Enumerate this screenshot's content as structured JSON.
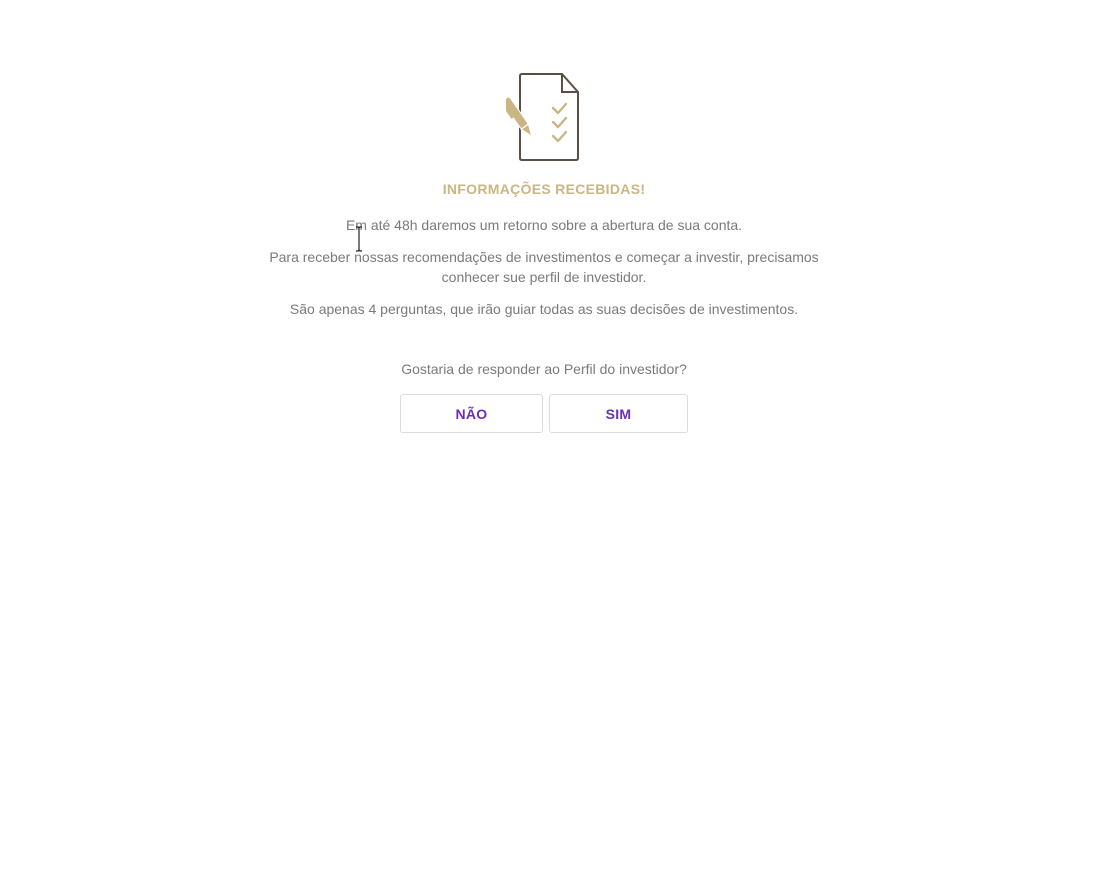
{
  "confirmation": {
    "icon": "document-checklist-pen-icon",
    "title": "INFORMAÇÕES RECEBIDAS!",
    "line1": "Em até 48h daremos um retorno sobre a abertura de sua conta.",
    "line2a": "Para receber nossas recomendações de investimentos e começar a investir, precisamos",
    "line2b": "conhecer sue perfil de investidor.",
    "line3": "São apenas 4 perguntas, que irão guiar todas as suas decisões de investimentos.",
    "question": "Gostaria de responder ao Perfil do investidor?",
    "no_label": "NÃO",
    "yes_label": "SIM"
  },
  "colors": {
    "accent_gold": "#c9b682",
    "text_gray": "#7a7a7a",
    "button_text_purple": "#6a2fb6",
    "icon_outline": "#5a4f44"
  }
}
